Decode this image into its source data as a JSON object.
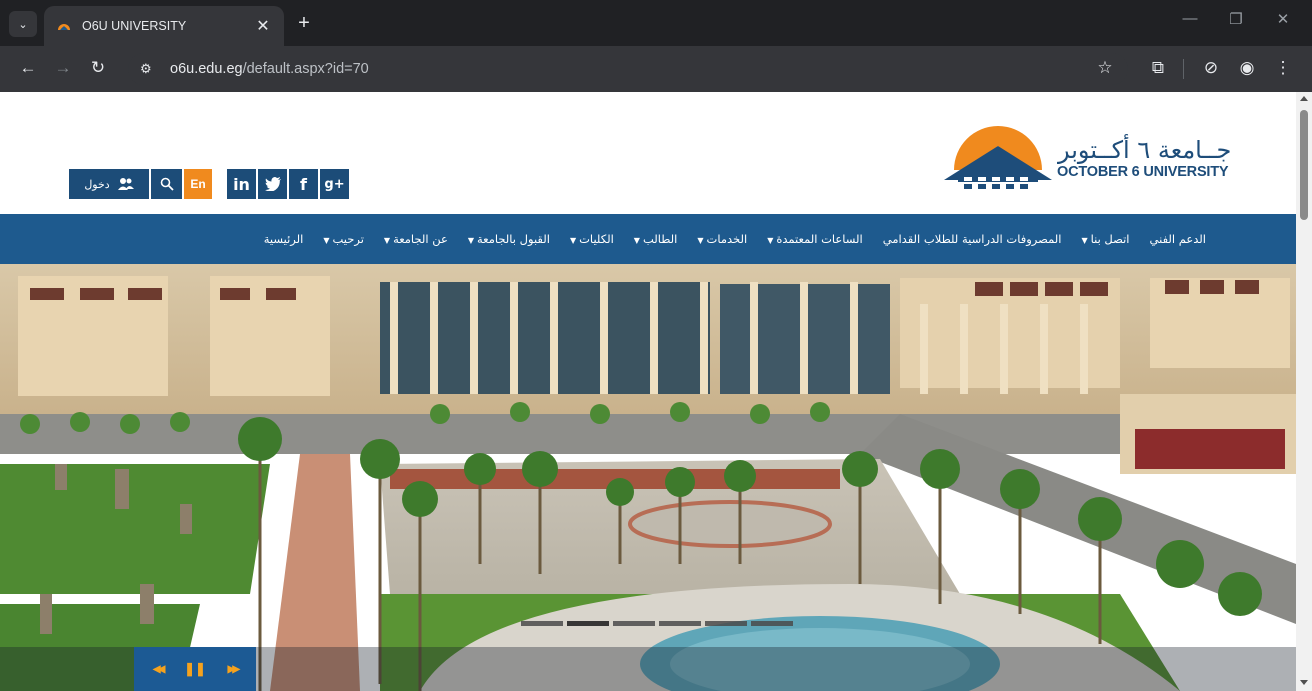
{
  "browser": {
    "tab_title": "O6U UNIVERSITY",
    "tab_close": "✕",
    "new_tab": "+",
    "url_host": "o6u.edu.eg",
    "url_path": "/default.aspx?id=70"
  },
  "header": {
    "logo_arabic": "جــامعة ٦ أكــتوبر",
    "logo_english": "OCTOBER 6 UNIVERSITY",
    "login_label": "دخول",
    "lang_label": "En"
  },
  "social": {
    "linkedin": "in",
    "twitter": "🐦",
    "facebook": "f",
    "googleplus": "g+"
  },
  "menu": {
    "items": [
      {
        "label": "الرئيسية",
        "dropdown": false
      },
      {
        "label": "ترحيب",
        "dropdown": true
      },
      {
        "label": "عن الجامعة",
        "dropdown": true
      },
      {
        "label": "القبول بالجامعة",
        "dropdown": true
      },
      {
        "label": "الكليات",
        "dropdown": true
      },
      {
        "label": "الطالب",
        "dropdown": true
      },
      {
        "label": "الخدمات",
        "dropdown": true
      },
      {
        "label": "الساعات المعتمدة",
        "dropdown": true
      },
      {
        "label": "المصروفات الدراسية للطلاب القدامي",
        "dropdown": false
      },
      {
        "label": "اتصل بنا",
        "dropdown": true
      },
      {
        "label": "الدعم الفني",
        "dropdown": false
      }
    ]
  },
  "slider": {
    "slide_count": 6,
    "active_slide": 2,
    "controls": {
      "prev": "◀◀",
      "pause": "❚❚",
      "next": "▶▶"
    }
  },
  "colors": {
    "brand_blue": "#1e5a8e",
    "brand_orange": "#f08a1e"
  }
}
